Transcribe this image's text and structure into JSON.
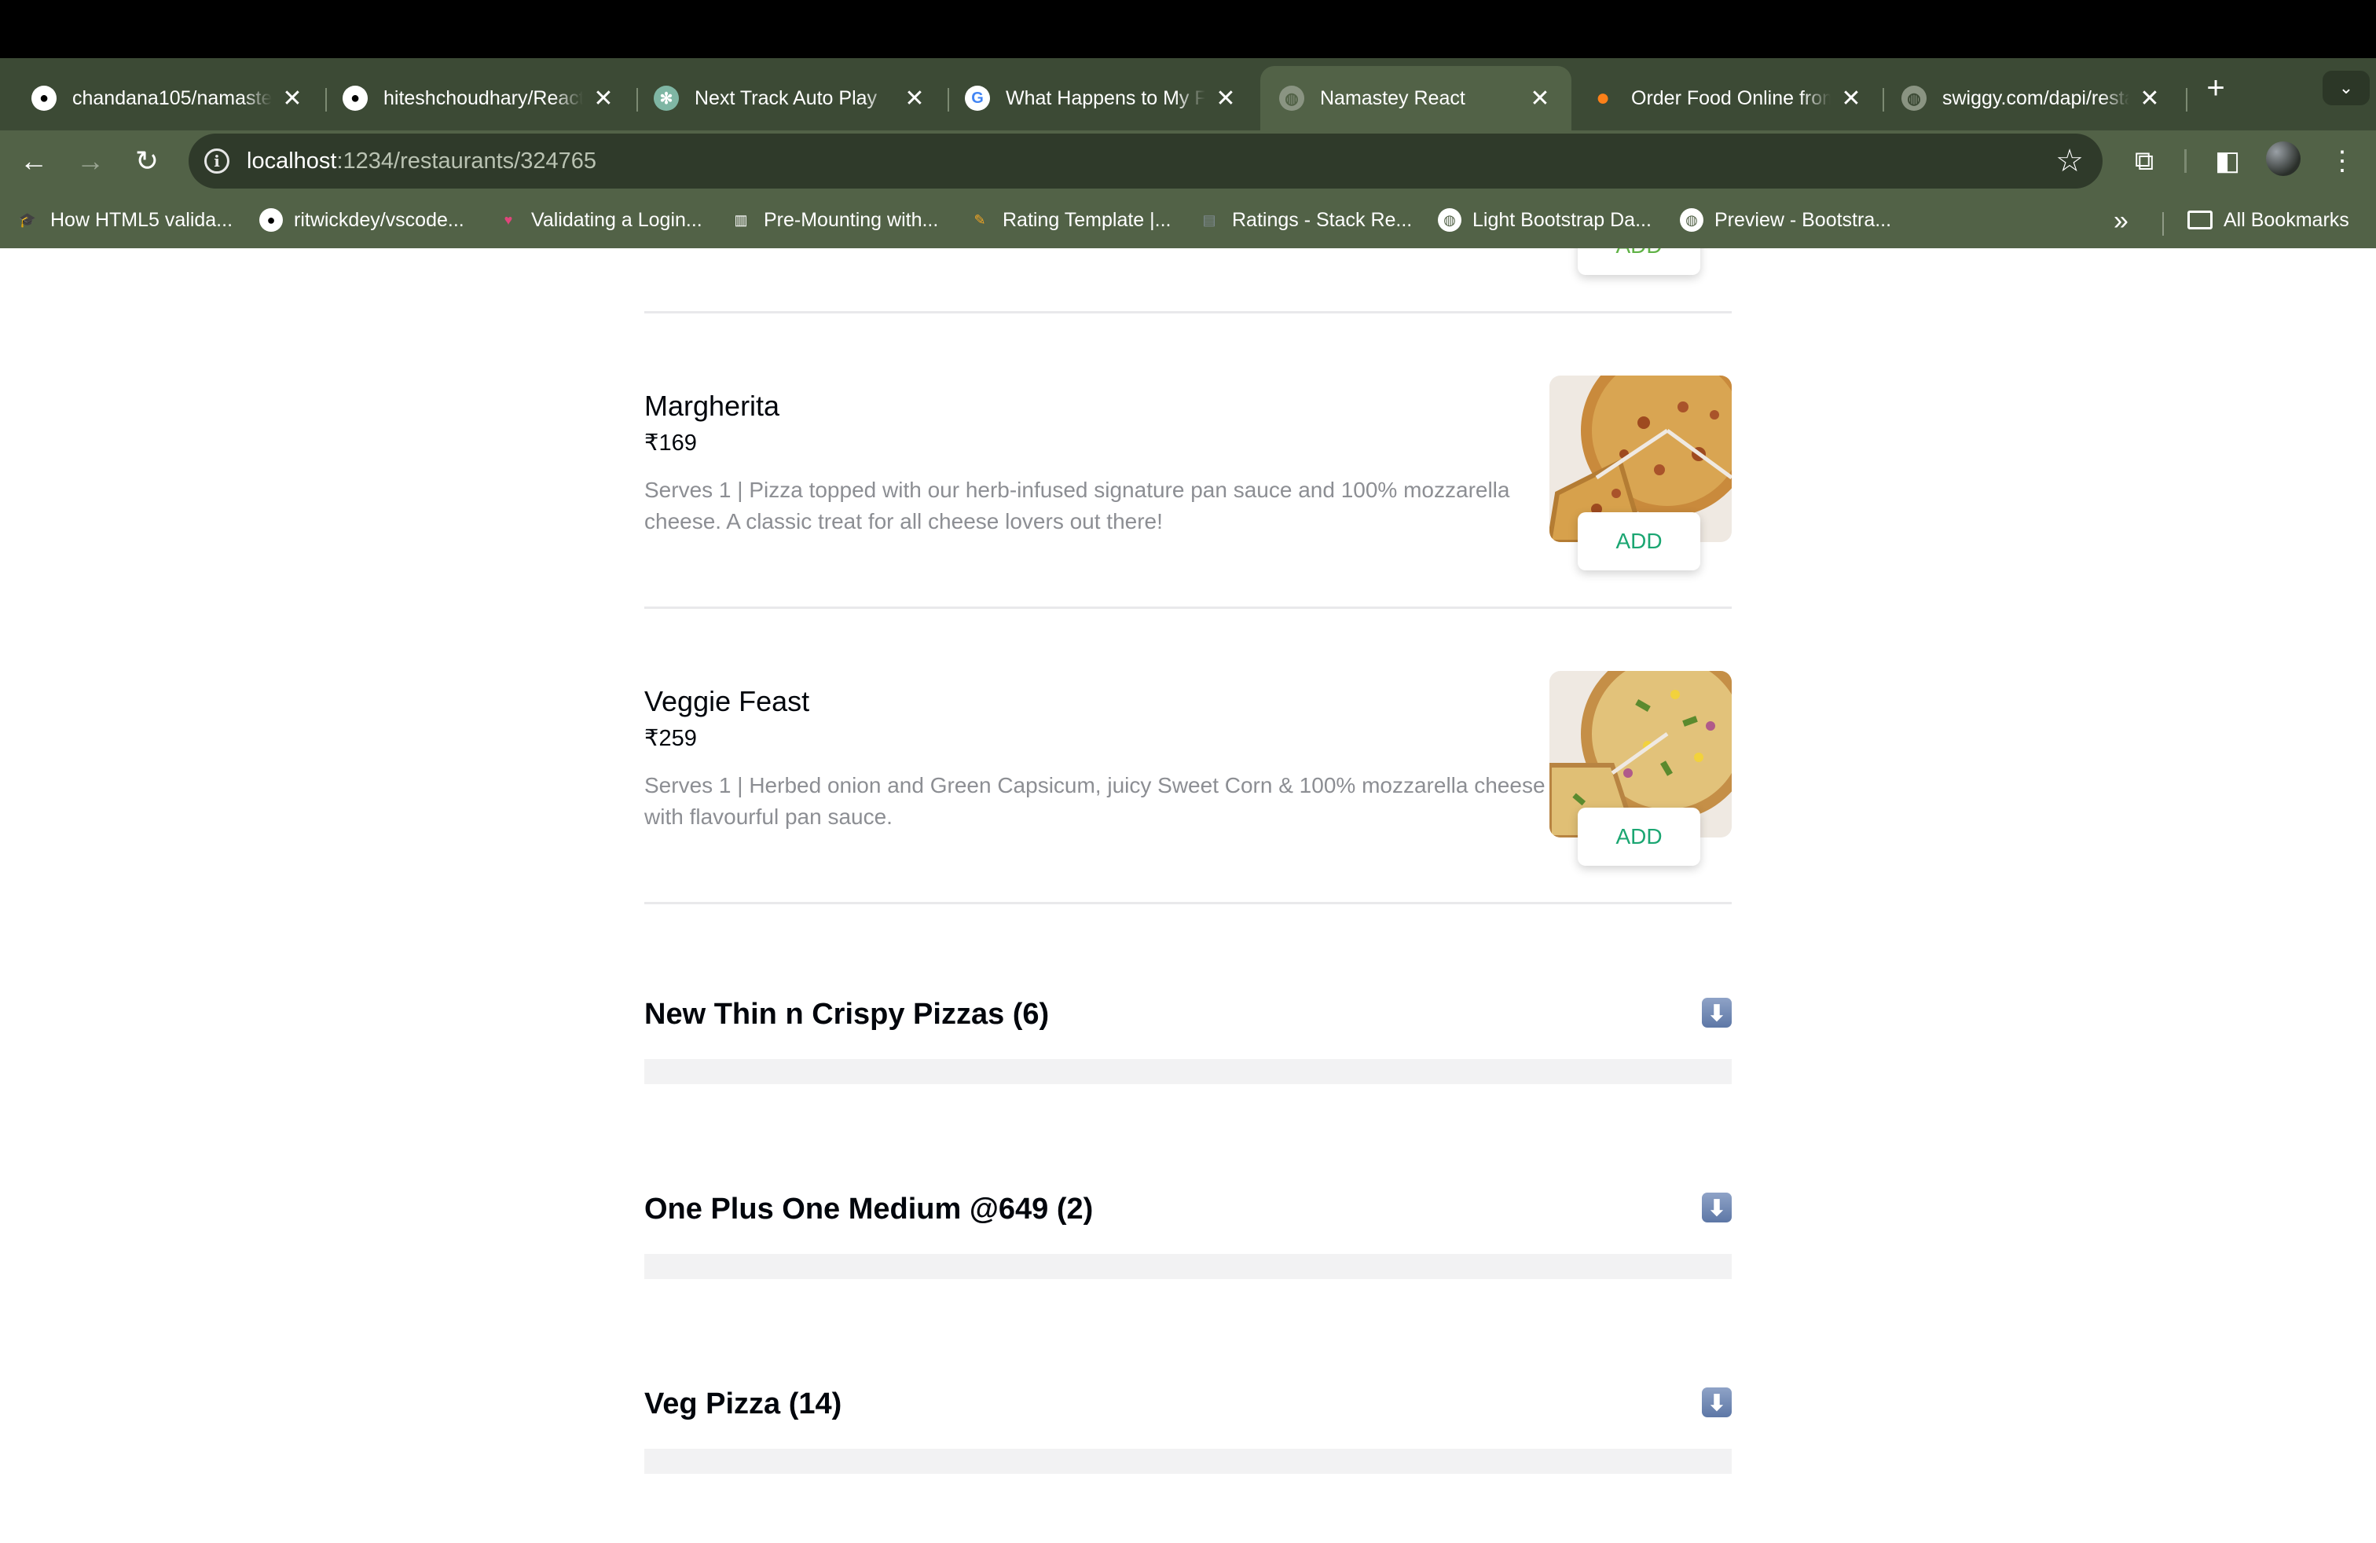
{
  "browser": {
    "tabs": [
      {
        "title": "chandana105/namaste",
        "icon": "github-icon",
        "active": false
      },
      {
        "title": "hiteshchoudhary/React",
        "icon": "github-icon",
        "active": false
      },
      {
        "title": "Next Track Auto Play",
        "icon": "openai-icon",
        "active": false
      },
      {
        "title": "What Happens to My F",
        "icon": "google-icon",
        "active": false
      },
      {
        "title": "Namastey React",
        "icon": "globe-icon",
        "active": true
      },
      {
        "title": "Order Food Online from",
        "icon": "swiggy-icon",
        "active": false
      },
      {
        "title": "swiggy.com/dapi/resta",
        "icon": "globe-icon",
        "active": false
      }
    ],
    "url_host": "localhost",
    "url_path": ":1234/restaurants/324765",
    "bookmarks": [
      {
        "label": "How HTML5 valida...",
        "icon": "graduation-cap-icon"
      },
      {
        "label": "ritwickdey/vscode...",
        "icon": "github-icon"
      },
      {
        "label": "Validating a Login...",
        "icon": "hearts-icon"
      },
      {
        "label": "Pre-Mounting with...",
        "icon": "map-icon"
      },
      {
        "label": "Rating Template |...",
        "icon": "rating-icon"
      },
      {
        "label": "Ratings - Stack Re...",
        "icon": "stackoverflow-icon"
      },
      {
        "label": "Light Bootstrap Da...",
        "icon": "globe-icon"
      },
      {
        "label": "Preview - Bootstra...",
        "icon": "globe-icon"
      }
    ],
    "all_bookmarks_label": "All Bookmarks"
  },
  "menu": {
    "partial_add_label": "ADD",
    "items": [
      {
        "name": "Margherita",
        "price": "₹169",
        "description": "Serves 1 | Pizza topped with our herb-infused signature pan sauce and 100% mozzarella cheese. A classic treat for all cheese lovers out there!",
        "add_label": "ADD"
      },
      {
        "name": "Veggie Feast",
        "price": "₹259",
        "description": "Serves 1 | Herbed onion and Green Capsicum, juicy Sweet Corn & 100% mozzarella cheese with flavourful pan sauce.",
        "add_label": "ADD"
      }
    ],
    "categories": [
      {
        "title": "New Thin n Crispy Pizzas (6)",
        "toggle_icon": "down-arrow-icon"
      },
      {
        "title": "One Plus One Medium @649 (2)",
        "toggle_icon": "down-arrow-icon"
      },
      {
        "title": "Veg Pizza (14)",
        "toggle_icon": "down-arrow-icon"
      }
    ]
  },
  "colors": {
    "add_text": "#1ba672",
    "chrome_frame": "#3c4a35",
    "chrome_toolbar": "#526247"
  }
}
